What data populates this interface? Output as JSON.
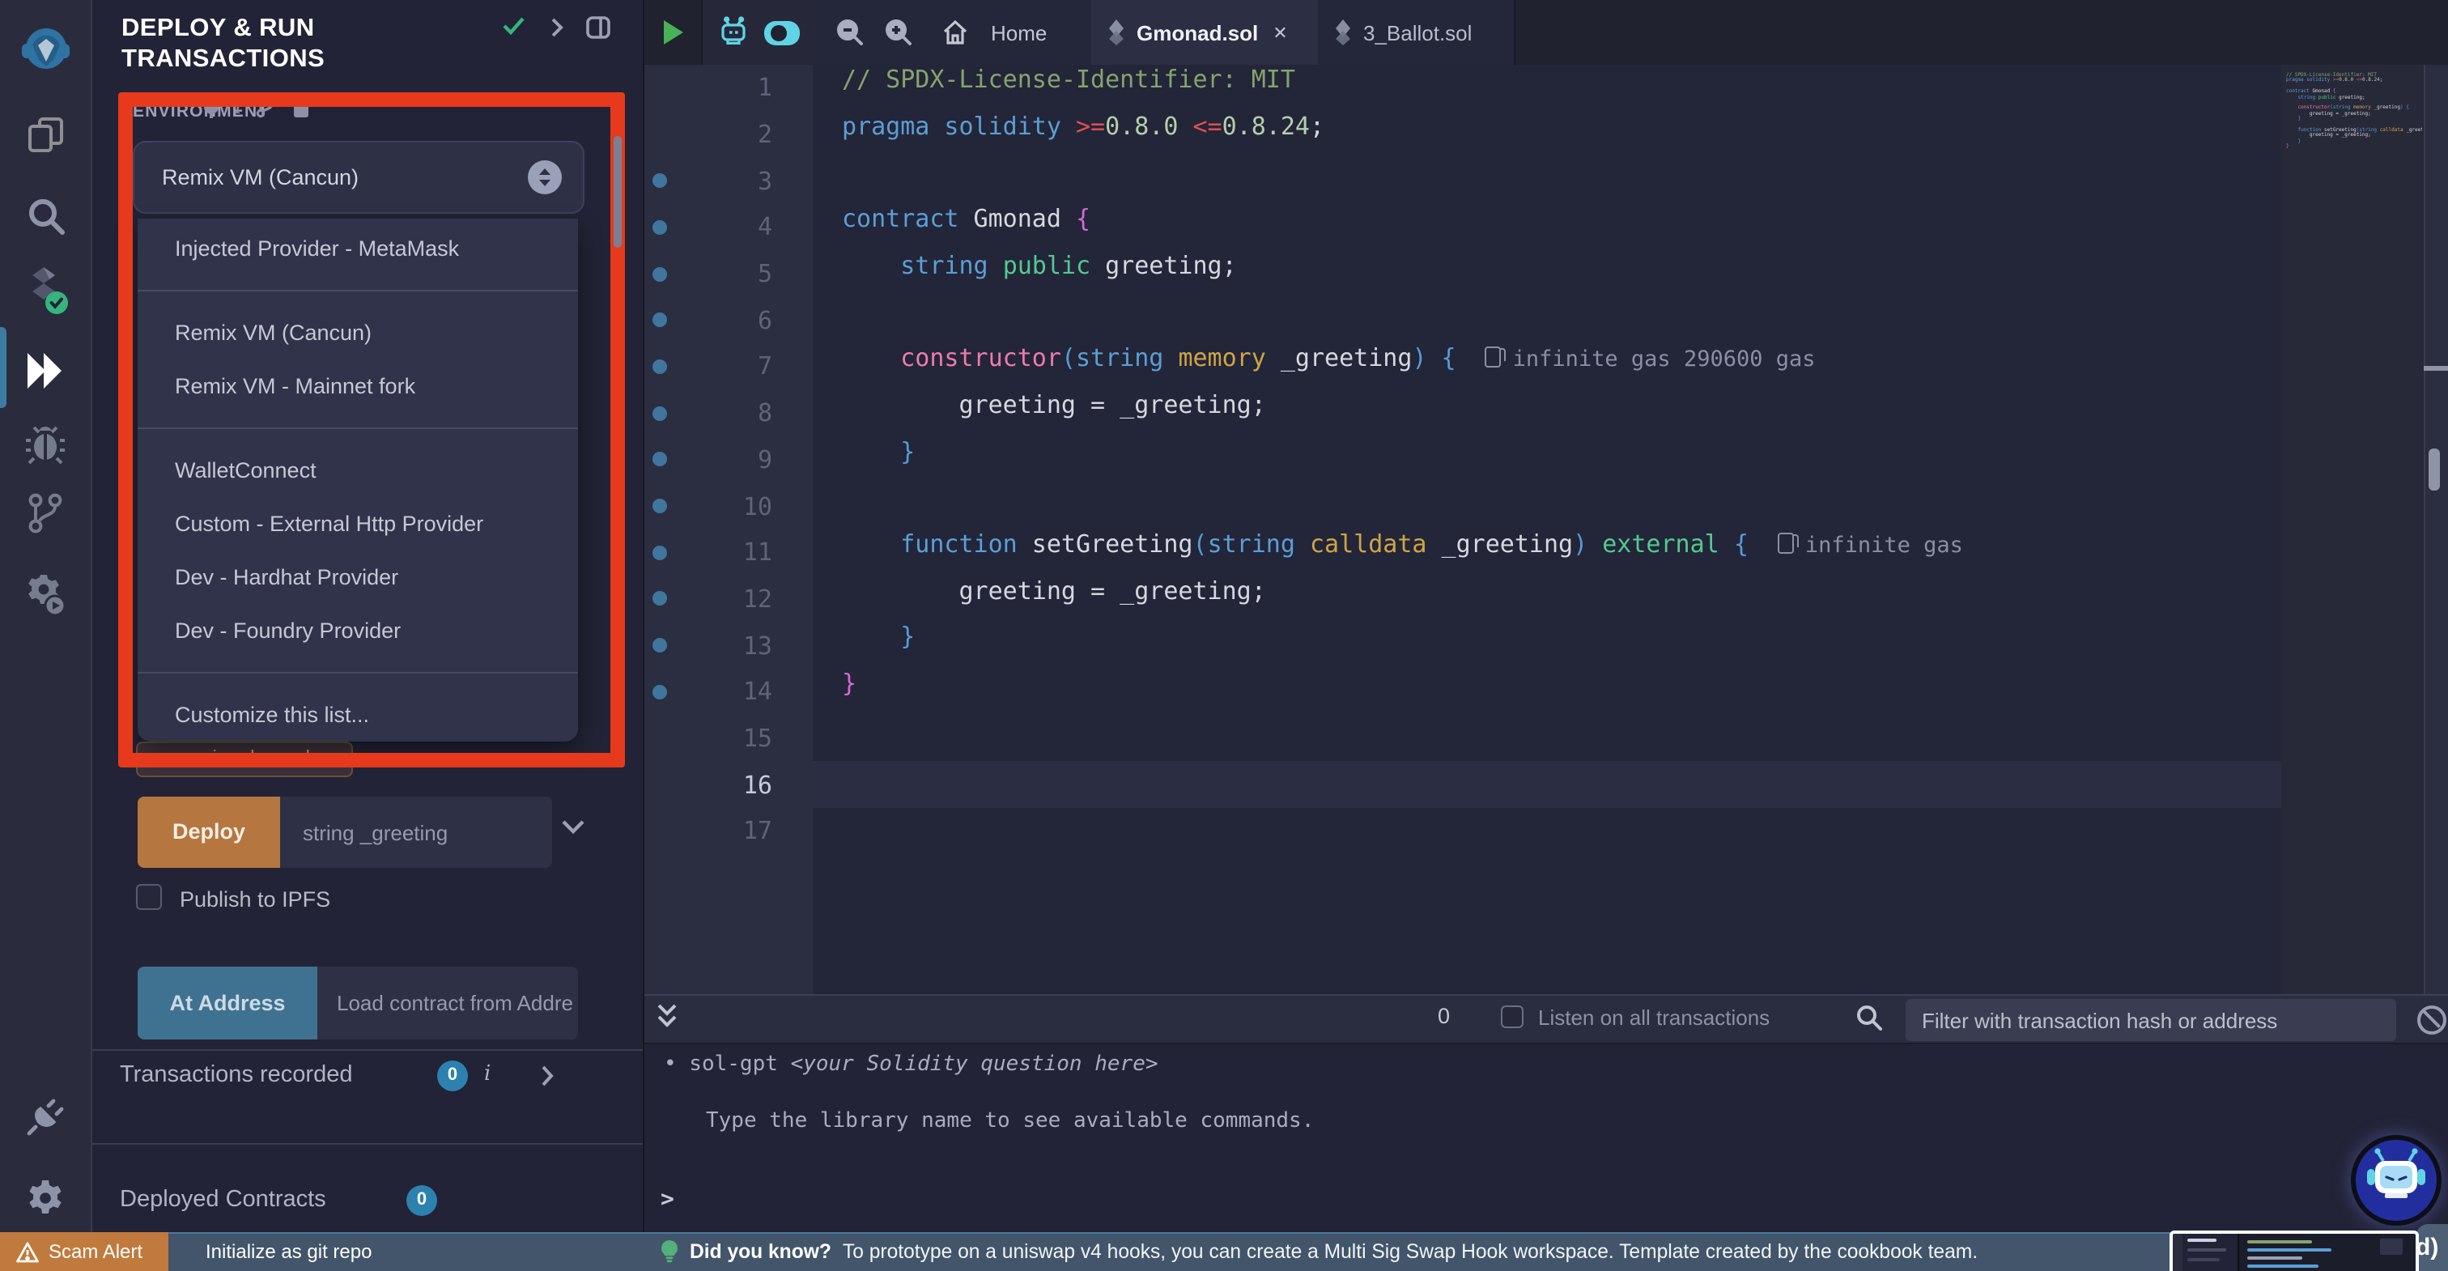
{
  "panel": {
    "title": "DEPLOY & RUN TRANSACTIONS",
    "environment": {
      "label": "ENVIRONMENT",
      "selected": "Remix VM (Cancun)",
      "options": [
        {
          "label": "Injected Provider - MetaMask"
        },
        {
          "divider": true
        },
        {
          "label": "Remix VM (Cancun)"
        },
        {
          "label": "Remix VM - Mainnet fork"
        },
        {
          "divider": true
        },
        {
          "label": "WalletConnect"
        },
        {
          "label": "Custom - External Http Provider"
        },
        {
          "label": "Dev - Hardhat Provider"
        },
        {
          "label": "Dev - Foundry Provider"
        },
        {
          "divider": true
        },
        {
          "label": "Customize this list..."
        }
      ],
      "toast_fragment": "version changed"
    },
    "deploy": {
      "button": "Deploy",
      "placeholder": "string _greeting"
    },
    "publish_label": "Publish to IPFS",
    "at_address": {
      "button": "At Address",
      "placeholder": "Load contract from Addre"
    },
    "transactions": {
      "label": "Transactions recorded",
      "count": "0",
      "info_icon": "i"
    },
    "deployed": {
      "label": "Deployed Contracts",
      "count": "0"
    }
  },
  "editor": {
    "toolbar": {
      "home": "Home",
      "tabs": [
        {
          "label": "Gmonad.sol",
          "close": "✕"
        },
        {
          "label": "3_Ballot.sol"
        }
      ]
    },
    "current_line": 16,
    "total_lines": 17,
    "gutter_dots": [
      3,
      4,
      5,
      6,
      7,
      8,
      9,
      10,
      11,
      12,
      13,
      14
    ],
    "lines": [
      [
        {
          "c": "cm",
          "t": "// SPDX-License-Identifier: MIT"
        }
      ],
      [
        {
          "c": "kw",
          "t": "pragma solidity "
        },
        {
          "c": "op",
          "t": ">="
        },
        {
          "c": "num",
          "t": "0.8.0"
        },
        {
          "c": "pl",
          "t": " "
        },
        {
          "c": "op",
          "t": "<="
        },
        {
          "c": "num",
          "t": "0.8.24"
        },
        {
          "c": "pl",
          "t": ";"
        }
      ],
      [],
      [
        {
          "c": "kw",
          "t": "contract"
        },
        {
          "c": "pl",
          "t": " Gmonad "
        },
        {
          "c": "b1",
          "t": "{"
        }
      ],
      [
        {
          "c": "pl",
          "t": "    "
        },
        {
          "c": "kw",
          "t": "string"
        },
        {
          "c": "pl",
          "t": " "
        },
        {
          "c": "mod",
          "t": "public"
        },
        {
          "c": "pl",
          "t": " greeting;"
        }
      ],
      [],
      [
        {
          "c": "pl",
          "t": "    "
        },
        {
          "c": "fn",
          "t": "constructor"
        },
        {
          "c": "b2",
          "t": "("
        },
        {
          "c": "kw",
          "t": "string"
        },
        {
          "c": "pl",
          "t": " "
        },
        {
          "c": "stor",
          "t": "memory"
        },
        {
          "c": "pl",
          "t": " _greeting"
        },
        {
          "c": "b2",
          "t": ") {"
        },
        {
          "c": "gas",
          "t": "infinite gas 290600 gas"
        }
      ],
      [
        {
          "c": "pl",
          "t": "        greeting = _greeting;"
        }
      ],
      [
        {
          "c": "pl",
          "t": "    "
        },
        {
          "c": "b2",
          "t": "}"
        }
      ],
      [],
      [
        {
          "c": "pl",
          "t": "    "
        },
        {
          "c": "kw",
          "t": "function"
        },
        {
          "c": "pl",
          "t": " setGreeting"
        },
        {
          "c": "b2",
          "t": "("
        },
        {
          "c": "kw",
          "t": "string"
        },
        {
          "c": "pl",
          "t": " "
        },
        {
          "c": "stor",
          "t": "calldata"
        },
        {
          "c": "pl",
          "t": " _greeting"
        },
        {
          "c": "b2",
          "t": ")"
        },
        {
          "c": "pl",
          "t": " "
        },
        {
          "c": "mod",
          "t": "external"
        },
        {
          "c": "pl",
          "t": " "
        },
        {
          "c": "b2",
          "t": "{"
        },
        {
          "c": "gas",
          "t": "infinite gas"
        }
      ],
      [
        {
          "c": "pl",
          "t": "        greeting = _greeting;"
        }
      ],
      [
        {
          "c": "pl",
          "t": "    "
        },
        {
          "c": "b2",
          "t": "}"
        }
      ],
      [
        {
          "c": "b1",
          "t": "}"
        }
      ],
      [],
      [],
      []
    ]
  },
  "terminal": {
    "count": "0",
    "listen_label": "Listen on all transactions",
    "filter_placeholder": "Filter with transaction hash or address",
    "line1_prefix": "• sol-gpt ",
    "line1_italic": "<your Solidity question here>",
    "line2": "Type the library name to see available commands.",
    "prompt": ">"
  },
  "statusbar": {
    "scam_alert": "Scam Alert",
    "git_init": "Initialize as git repo",
    "tip_bold": "Did you know?",
    "tip_text": "To prototype on a uniswap v4 hooks, you can create a Multi Sig Swap Hook workspace. Template created by the cookbook team.",
    "corner_fragment": "d)"
  },
  "colors": {
    "accent_red": "#e73a1c",
    "deploy_orange": "#b5763f",
    "at_address_blue": "#3f7191",
    "badge_blue": "#2d81ae",
    "check_green": "#35b57d",
    "scam_orange": "#c17a3d",
    "icon_cyan": "#5fd4e4",
    "play_green": "#49b156"
  }
}
